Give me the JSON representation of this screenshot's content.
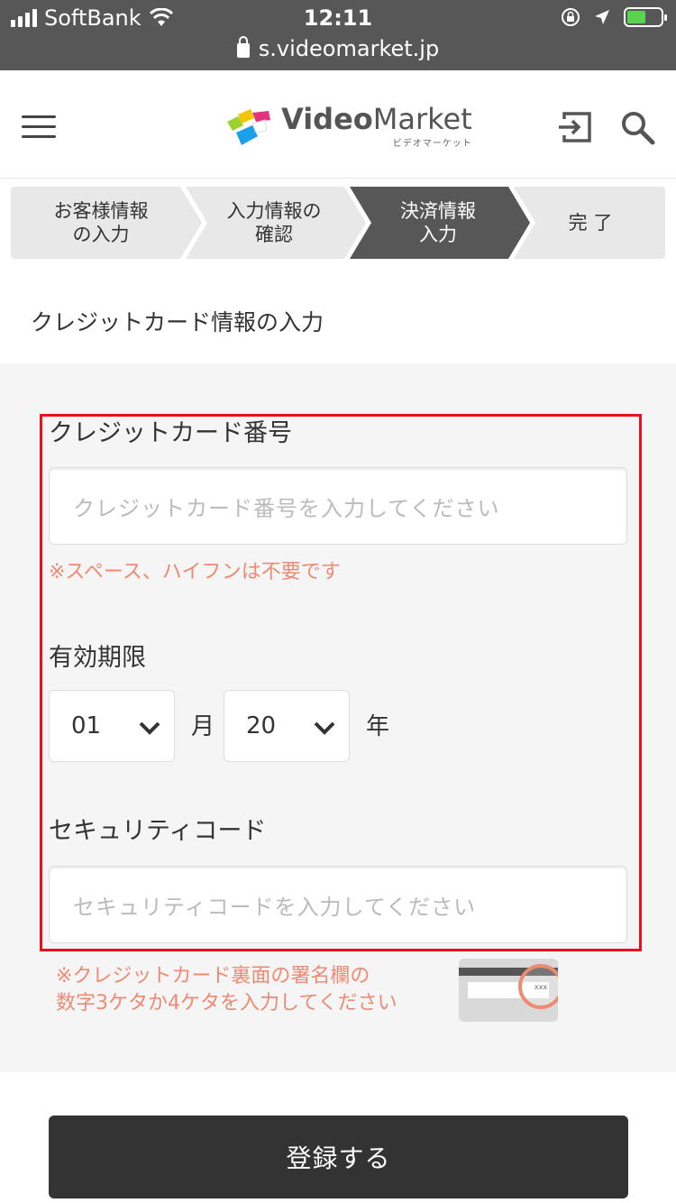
{
  "status_bar": {
    "carrier": "SoftBank",
    "time": "12:11",
    "url": "s.videomarket.jp"
  },
  "header": {
    "logo_bold": "Video",
    "logo_rest": "Market",
    "logo_sub": "ビデオマーケット"
  },
  "steps": [
    {
      "line1": "お客様情報",
      "line2": "の入力"
    },
    {
      "line1": "入力情報の",
      "line2": "確認"
    },
    {
      "line1": "決済情報",
      "line2": "入力"
    },
    {
      "line1": "完 了",
      "line2": ""
    }
  ],
  "section_title": "クレジットカード情報の入力",
  "card_number": {
    "label": "クレジットカード番号",
    "placeholder": "クレジットカード番号を入力してください",
    "note": "※スペース、ハイフンは不要です"
  },
  "expiry": {
    "label": "有効期限",
    "month_value": "01",
    "month_unit": "月",
    "year_value": "20",
    "year_unit": "年"
  },
  "security_code": {
    "label": "セキュリティコード",
    "placeholder": "セキュリティコードを入力してください",
    "note_line1": "※クレジットカード裏面の署名欄の",
    "note_line2": "数字3ケタか4ケタを入力してください",
    "card_text": "xxx"
  },
  "submit_label": "登録する",
  "colors": {
    "accent_red": "#e8111c",
    "note": "#ef8a72",
    "active_step": "#575757",
    "button": "#333333"
  }
}
